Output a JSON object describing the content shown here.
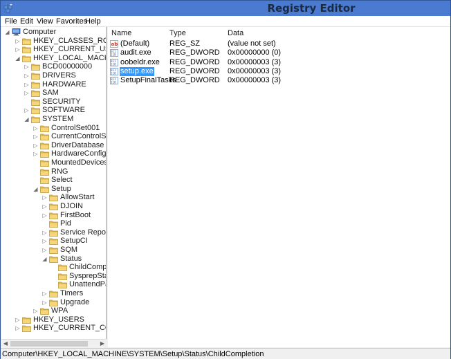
{
  "window": {
    "title": "Registry Editor"
  },
  "menu": [
    "File",
    "Edit",
    "View",
    "Favorites",
    "Help"
  ],
  "tree": [
    {
      "label": "Computer",
      "depth": 0,
      "expander": "expanded",
      "icon": "computer-icon"
    },
    {
      "label": "HKEY_CLASSES_ROOT",
      "depth": 1,
      "expander": "collapsed",
      "icon": "folder-icon"
    },
    {
      "label": "HKEY_CURRENT_USER",
      "depth": 1,
      "expander": "collapsed",
      "icon": "folder-icon"
    },
    {
      "label": "HKEY_LOCAL_MACHINE",
      "depth": 1,
      "expander": "expanded",
      "icon": "folder-icon"
    },
    {
      "label": "BCD00000000",
      "depth": 2,
      "expander": "collapsed",
      "icon": "folder-icon"
    },
    {
      "label": "DRIVERS",
      "depth": 2,
      "expander": "collapsed",
      "icon": "folder-icon"
    },
    {
      "label": "HARDWARE",
      "depth": 2,
      "expander": "collapsed",
      "icon": "folder-icon"
    },
    {
      "label": "SAM",
      "depth": 2,
      "expander": "collapsed",
      "icon": "folder-icon"
    },
    {
      "label": "SECURITY",
      "depth": 2,
      "expander": "none",
      "icon": "folder-icon"
    },
    {
      "label": "SOFTWARE",
      "depth": 2,
      "expander": "collapsed",
      "icon": "folder-icon"
    },
    {
      "label": "SYSTEM",
      "depth": 2,
      "expander": "expanded",
      "icon": "folder-icon"
    },
    {
      "label": "ControlSet001",
      "depth": 3,
      "expander": "collapsed",
      "icon": "folder-icon"
    },
    {
      "label": "CurrentControlSet",
      "depth": 3,
      "expander": "collapsed",
      "icon": "folder-icon"
    },
    {
      "label": "DriverDatabase",
      "depth": 3,
      "expander": "collapsed",
      "icon": "folder-icon"
    },
    {
      "label": "HardwareConfig",
      "depth": 3,
      "expander": "collapsed",
      "icon": "folder-icon"
    },
    {
      "label": "MountedDevices",
      "depth": 3,
      "expander": "none",
      "icon": "folder-icon"
    },
    {
      "label": "RNG",
      "depth": 3,
      "expander": "none",
      "icon": "folder-icon"
    },
    {
      "label": "Select",
      "depth": 3,
      "expander": "none",
      "icon": "folder-icon"
    },
    {
      "label": "Setup",
      "depth": 3,
      "expander": "expanded",
      "icon": "folder-icon"
    },
    {
      "label": "AllowStart",
      "depth": 4,
      "expander": "collapsed",
      "icon": "folder-icon"
    },
    {
      "label": "DJOIN",
      "depth": 4,
      "expander": "collapsed",
      "icon": "folder-icon"
    },
    {
      "label": "FirstBoot",
      "depth": 4,
      "expander": "collapsed",
      "icon": "folder-icon"
    },
    {
      "label": "Pid",
      "depth": 4,
      "expander": "none",
      "icon": "folder-icon"
    },
    {
      "label": "Service Reporting",
      "depth": 4,
      "expander": "collapsed",
      "icon": "folder-icon"
    },
    {
      "label": "SetupCI",
      "depth": 4,
      "expander": "collapsed",
      "icon": "folder-icon"
    },
    {
      "label": "SQM",
      "depth": 4,
      "expander": "collapsed",
      "icon": "folder-icon"
    },
    {
      "label": "Status",
      "depth": 4,
      "expander": "expanded",
      "icon": "folder-icon"
    },
    {
      "label": "ChildComplet",
      "depth": 5,
      "expander": "none",
      "icon": "folder-icon"
    },
    {
      "label": "SysprepStatus",
      "depth": 5,
      "expander": "none",
      "icon": "folder-icon"
    },
    {
      "label": "UnattendPass",
      "depth": 5,
      "expander": "none",
      "icon": "folder-icon"
    },
    {
      "label": "Timers",
      "depth": 4,
      "expander": "collapsed",
      "icon": "folder-icon"
    },
    {
      "label": "Upgrade",
      "depth": 4,
      "expander": "collapsed",
      "icon": "folder-icon"
    },
    {
      "label": "WPA",
      "depth": 3,
      "expander": "collapsed",
      "icon": "folder-icon"
    },
    {
      "label": "HKEY_USERS",
      "depth": 1,
      "expander": "collapsed",
      "icon": "folder-icon"
    },
    {
      "label": "HKEY_CURRENT_CONFIG",
      "depth": 1,
      "expander": "collapsed",
      "icon": "folder-icon"
    }
  ],
  "list": {
    "columns": {
      "name": "Name",
      "type": "Type",
      "data": "Data"
    },
    "rows": [
      {
        "name": "(Default)",
        "type": "REG_SZ",
        "data": "(value not set)",
        "icon": "string-value-icon",
        "selected": false
      },
      {
        "name": "audit.exe",
        "type": "REG_DWORD",
        "data": "0x00000000 (0)",
        "icon": "binary-value-icon",
        "selected": false
      },
      {
        "name": "oobeldr.exe",
        "type": "REG_DWORD",
        "data": "0x00000003 (3)",
        "icon": "binary-value-icon",
        "selected": false
      },
      {
        "name": "setup.exe",
        "type": "REG_DWORD",
        "data": "0x00000003 (3)",
        "icon": "binary-value-icon",
        "selected": true
      },
      {
        "name": "SetupFinalTasks",
        "type": "REG_DWORD",
        "data": "0x00000003 (3)",
        "icon": "binary-value-icon",
        "selected": false
      }
    ]
  },
  "statusbar": {
    "path": "Computer\\HKEY_LOCAL_MACHINE\\SYSTEM\\Setup\\Status\\ChildCompletion"
  },
  "colors": {
    "titlebar": "#4a7bd1",
    "selection": "#3399ff",
    "folder": "#e8c25a"
  }
}
